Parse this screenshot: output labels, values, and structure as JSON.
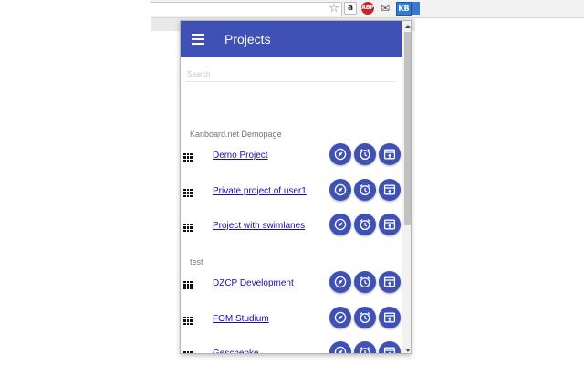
{
  "header": {
    "title": "Projects",
    "menu_icon": "menu-icon"
  },
  "search": {
    "placeholder": "Search",
    "value": ""
  },
  "groups": [
    {
      "title": "Kanboard.net Demopage",
      "projects": [
        "Demo Project",
        "Private project of user1",
        "Project with swimlanes"
      ]
    },
    {
      "title": "test",
      "projects": [
        "DZCP Development",
        "FOM Studium",
        "Geschenke"
      ]
    }
  ],
  "row_actions": [
    "compass-icon",
    "alarm-clock-icon",
    "board-icon"
  ],
  "toolbar_icons": {
    "star": "☆",
    "amazon": "a",
    "adblock": "ABP",
    "mail": "✉",
    "kanboard": "KB"
  },
  "colors": {
    "primary": "#3f51b5",
    "link": "#1a0dab",
    "group_title": "#757575"
  }
}
